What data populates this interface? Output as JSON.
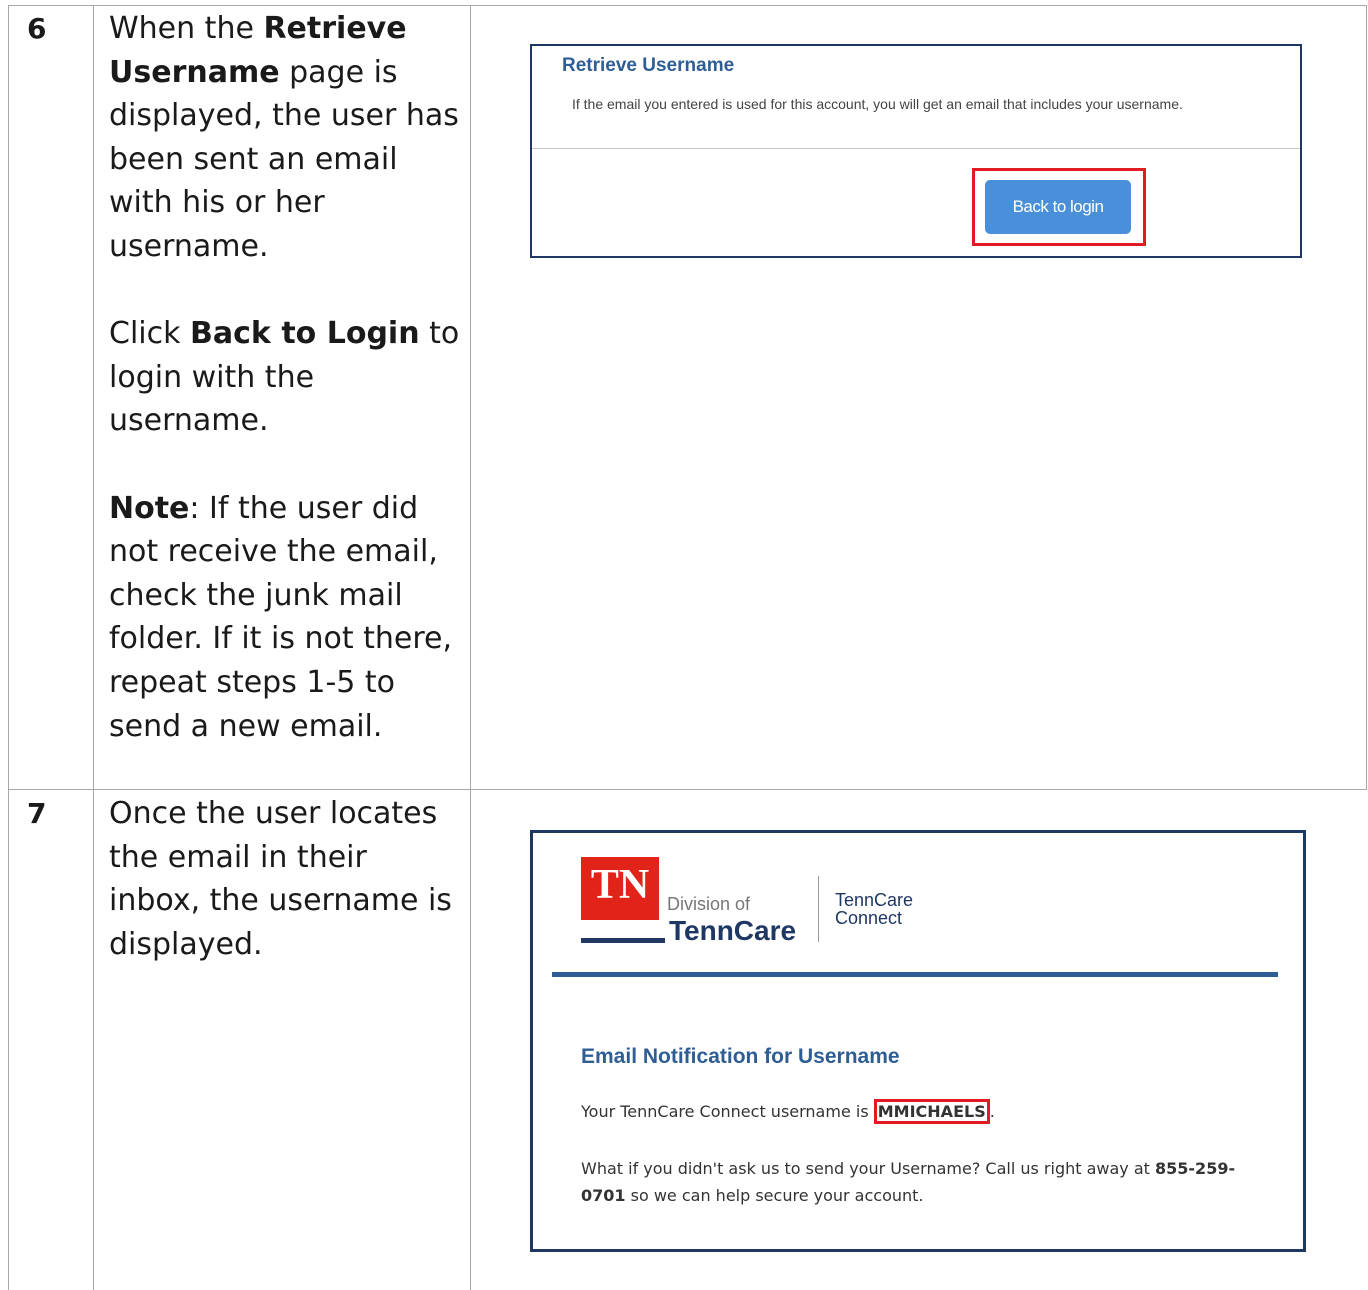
{
  "rows": [
    {
      "number": "6",
      "intro_before": "When the ",
      "intro_bold": "Retrieve Username",
      "intro_after": " page is displayed, the user has been sent an email with his or her username.",
      "click_before": "Click ",
      "click_bold": "Back to Login",
      "click_after": " to login with the username.",
      "note_bold": "Note",
      "note_after": ": If the user did not receive the email, check the junk mail folder. If it is not there, repeat steps 1-5 to send a new email."
    },
    {
      "number": "7",
      "text": "Once the user locates the email in their inbox, the username is displayed."
    }
  ],
  "retrieve_screen": {
    "title": "Retrieve Username",
    "message": "If the email you entered is used for this account, you will get an email that includes your username.",
    "button_label": "Back to login"
  },
  "email_screen": {
    "logo_state": "TN",
    "logo_division": "Division of",
    "logo_name": "TennCare",
    "product_line1": "TennCare",
    "product_line2": "Connect",
    "heading": "Email Notification for Username",
    "username_prefix": "Your TennCare Connect username is",
    "username": "MMICHAELS",
    "username_suffix": ".",
    "question": "What if you didn't ask us to send your Username? Call us right away at ",
    "phone": "855-259-0701",
    "question_end": " so we can help secure your account."
  },
  "colors": {
    "border_navy": "#1f3763",
    "heading_blue": "#2e5e94",
    "button_blue": "#4a8fd9",
    "highlight_red": "#e01b22",
    "tn_red": "#e2231a"
  }
}
